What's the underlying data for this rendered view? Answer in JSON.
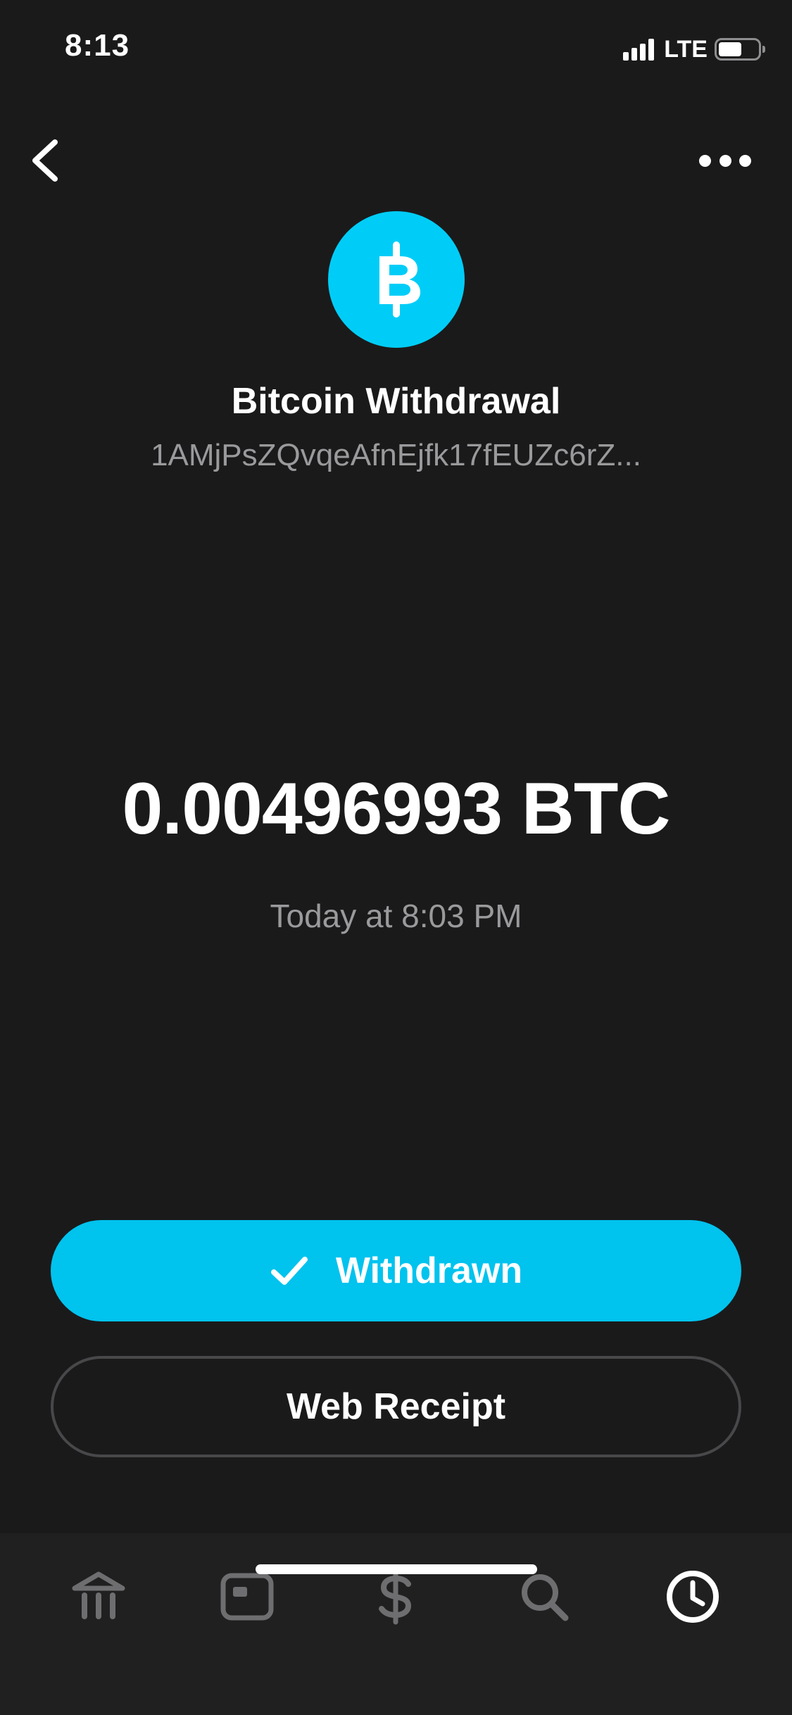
{
  "status_bar": {
    "time": "8:13",
    "network": "LTE"
  },
  "header": {
    "back_icon": "chevron-left-icon",
    "more_icon": "more-horizontal-icon"
  },
  "transaction": {
    "avatar_icon": "bitcoin-icon",
    "avatar_color": "#00cdf7",
    "title": "Bitcoin Withdrawal",
    "address": "1AMjPsZQvqeAfnEjfk17fEUZc6rZ...",
    "amount": "0.00496993 BTC",
    "timestamp": "Today at 8:03 PM"
  },
  "actions": {
    "status_label": "Withdrawn",
    "status_icon": "checkmark-icon",
    "status_color": "#00c3ee",
    "receipt_label": "Web Receipt"
  },
  "tab_bar": {
    "tabs": [
      {
        "icon": "bank-icon",
        "active": false
      },
      {
        "icon": "card-icon",
        "active": false
      },
      {
        "icon": "dollar-icon",
        "active": false
      },
      {
        "icon": "search-icon",
        "active": false
      },
      {
        "icon": "clock-icon",
        "active": true
      }
    ],
    "inactive_color": "#6e6e70",
    "active_color": "#ffffff"
  }
}
